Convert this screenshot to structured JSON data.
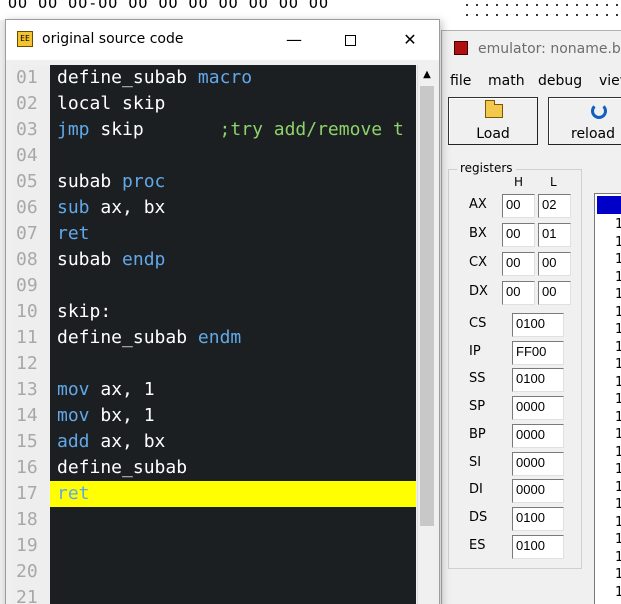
{
  "background": {
    "top_glyphs": "ŌŌ ŌŌ ŌŌ-ŌŌ ŌŌ ŌŌ ŌŌ ŌŌ ŌŌ ŌŌ ŌŌ"
  },
  "source_window": {
    "title": "original source code",
    "icon": "emu8086-app-icon",
    "controls": {
      "minimize": "—",
      "maximize": "maximize-icon",
      "close": "✕"
    },
    "lines": [
      {
        "n": "01",
        "tokens": [
          {
            "t": "define_subab ",
            "c": "w"
          },
          {
            "t": "macro",
            "c": "b"
          }
        ]
      },
      {
        "n": "02",
        "tokens": [
          {
            "t": "local skip",
            "c": "w"
          }
        ]
      },
      {
        "n": "03",
        "tokens": [
          {
            "t": "jmp",
            "c": "b"
          },
          {
            "t": " skip",
            "c": "w"
          },
          {
            "t": "       ;try add/remove t",
            "c": "g"
          }
        ]
      },
      {
        "n": "04",
        "tokens": []
      },
      {
        "n": "05",
        "tokens": [
          {
            "t": "subab ",
            "c": "w"
          },
          {
            "t": "proc",
            "c": "b"
          }
        ]
      },
      {
        "n": "06",
        "tokens": [
          {
            "t": "sub",
            "c": "b"
          },
          {
            "t": " ax, bx",
            "c": "w"
          }
        ]
      },
      {
        "n": "07",
        "tokens": [
          {
            "t": "ret",
            "c": "b"
          }
        ]
      },
      {
        "n": "08",
        "tokens": [
          {
            "t": "subab ",
            "c": "w"
          },
          {
            "t": "endp",
            "c": "b"
          }
        ]
      },
      {
        "n": "09",
        "tokens": []
      },
      {
        "n": "10",
        "tokens": [
          {
            "t": "skip:",
            "c": "w"
          }
        ]
      },
      {
        "n": "11",
        "tokens": [
          {
            "t": "define_subab ",
            "c": "w"
          },
          {
            "t": "endm",
            "c": "b"
          }
        ]
      },
      {
        "n": "12",
        "tokens": []
      },
      {
        "n": "13",
        "tokens": [
          {
            "t": "mov",
            "c": "b"
          },
          {
            "t": " ax, 1",
            "c": "w"
          }
        ]
      },
      {
        "n": "14",
        "tokens": [
          {
            "t": "mov",
            "c": "b"
          },
          {
            "t": " bx, 1",
            "c": "w"
          }
        ]
      },
      {
        "n": "15",
        "tokens": [
          {
            "t": "add",
            "c": "b"
          },
          {
            "t": " ax, bx",
            "c": "w"
          }
        ]
      },
      {
        "n": "16",
        "tokens": [
          {
            "t": "define_subab",
            "c": "w"
          }
        ]
      },
      {
        "n": "17",
        "tokens": [
          {
            "t": "ret",
            "c": "b"
          }
        ],
        "highlight": true
      },
      {
        "n": "18",
        "tokens": []
      },
      {
        "n": "19",
        "tokens": []
      },
      {
        "n": "20",
        "tokens": []
      },
      {
        "n": "21",
        "tokens": []
      }
    ],
    "colors": {
      "editor_bg": "#1b1f22",
      "keyword": "#62a8e8",
      "comment": "#8fd16a",
      "highlight": "#ffff00"
    }
  },
  "emulator_window": {
    "title": "emulator: noname.bin",
    "menu": [
      "file",
      "math",
      "debug",
      "view"
    ],
    "toolbar": {
      "load_label": "Load",
      "reload_label": "reload"
    },
    "registers": {
      "legend": "registers",
      "h_label": "H",
      "l_label": "L",
      "gp": [
        {
          "name": "AX",
          "h": "00",
          "l": "02"
        },
        {
          "name": "BX",
          "h": "00",
          "l": "01"
        },
        {
          "name": "CX",
          "h": "00",
          "l": "00"
        },
        {
          "name": "DX",
          "h": "00",
          "l": "00"
        }
      ],
      "seg": [
        {
          "name": "CS",
          "value": "0100"
        },
        {
          "name": "IP",
          "value": "FF00"
        },
        {
          "name": "SS",
          "value": "0100"
        },
        {
          "name": "SP",
          "value": "0000"
        },
        {
          "name": "BP",
          "value": "0000"
        },
        {
          "name": "SI",
          "value": "0000"
        },
        {
          "name": "DI",
          "value": "0000"
        },
        {
          "name": "DS",
          "value": "0100"
        },
        {
          "name": "ES",
          "value": "0100"
        }
      ]
    },
    "memory_list_rows": [
      "1",
      "1",
      "1",
      "1",
      "1",
      "1",
      "1",
      "1",
      "1",
      "1",
      "1",
      "1",
      "1",
      "1",
      "1",
      "1",
      "1",
      "1",
      "1",
      "1",
      "1",
      "1"
    ]
  }
}
